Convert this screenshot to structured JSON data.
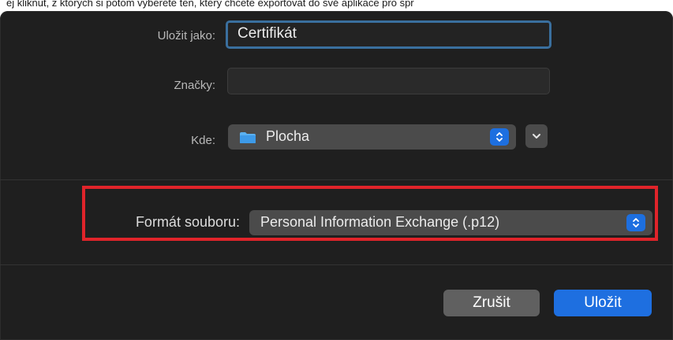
{
  "caption": "ej kliknut, z ktorých si potom vyberete ten, který chcete exportovat do své aplikace pro spr",
  "dialog": {
    "save_as": {
      "label": "Uložit jako:",
      "value": "Certifikát"
    },
    "tags": {
      "label": "Značky:",
      "value": ""
    },
    "where": {
      "label": "Kde:",
      "value": "Plocha",
      "icon": "folder-icon"
    },
    "format": {
      "label": "Formát souboru:",
      "value": "Personal Information Exchange (.p12)"
    },
    "buttons": {
      "cancel": "Zrušit",
      "save": "Uložit"
    }
  },
  "colors": {
    "dialog_bg": "#1f1f1f",
    "accent": "#1e6fe0",
    "highlight": "#e0242a",
    "focus_ring": "#3a6f9e"
  }
}
